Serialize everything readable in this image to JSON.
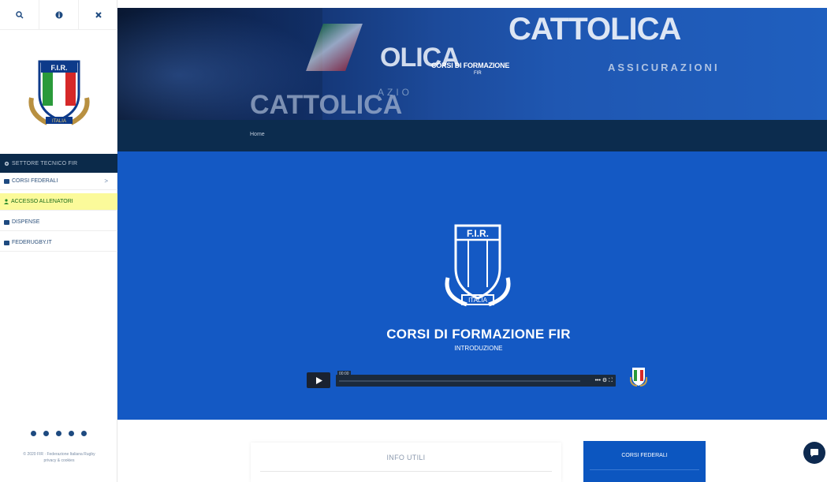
{
  "sidebar": {
    "nav_header": "SETTORE TECNICO FIR",
    "items": [
      {
        "label": "CORSI FEDERALI",
        "chevron": ">"
      },
      {
        "label": "ACCESSO ALLENATORI"
      },
      {
        "label": "DISPENSE"
      },
      {
        "label": "FEDERUGBY.IT"
      }
    ],
    "copyright": "© 2020 FIR · Federazione Italiana Rugby",
    "copyright_line2": "privacy & cookies",
    "highlight_color": "#fbfa9a",
    "nav_color": "#0b2a4a"
  },
  "banner": {
    "title": "CORSI DI FORMAZIONE",
    "subtitle": "FIR",
    "brand_big": "CATTOLICA",
    "brand_low": "CATTOLICA",
    "brand_mid": "OLICA",
    "assicurazioni": "ASSICURAZIONI",
    "azio": "AZIO"
  },
  "breadcrumb": {
    "home": "Home"
  },
  "video": {
    "title": "CORSI DI FORMAZIONE FIR",
    "subtitle": "INTRODUZIONE",
    "time": "00:00",
    "controls": "••• ⚙ ⛶"
  },
  "content": {
    "info_title": "INFO UTILI",
    "corsi_title": "CORSI FEDERALI"
  },
  "colors": {
    "primary_blue": "#1459c4",
    "dark_navy": "#0c2c4e",
    "arrow_yellow": "#f4e81a"
  }
}
